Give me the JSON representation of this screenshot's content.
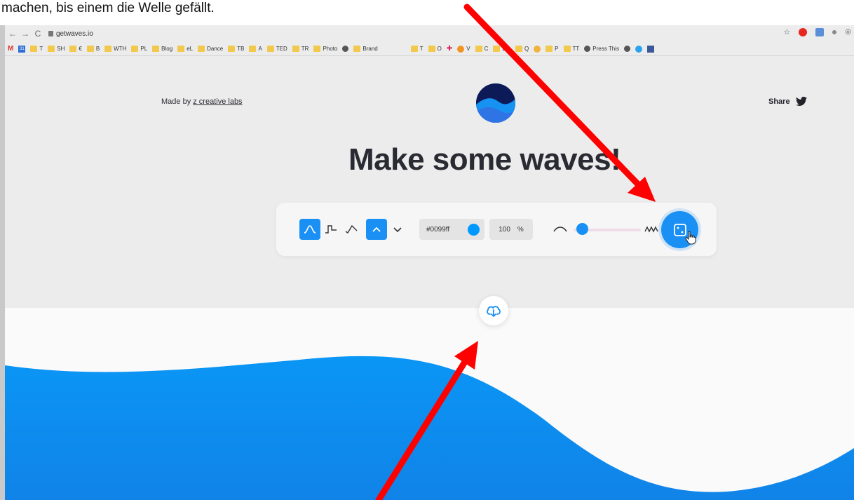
{
  "caption": "machen, bis einem die Welle gefällt.",
  "browser": {
    "url": "getwaves.io",
    "bookmarks": [
      "T",
      "SH",
      "€",
      "B",
      "WTH",
      "PL",
      "Blog",
      "eL",
      "Dance",
      "TB",
      "A",
      "TED",
      "TR",
      "Photo",
      "Brand",
      "T",
      "O",
      "V",
      "C",
      "EO",
      "Q",
      "P",
      "TT",
      "Press This"
    ]
  },
  "page": {
    "made_by_prefix": "Made by ",
    "made_by_link": "z creative labs",
    "share_label": "Share",
    "headline": "Make some waves!"
  },
  "toolbar": {
    "color_hex": "#0099ff",
    "opacity_value": "100",
    "opacity_unit": "%",
    "complexity_level": 0.05
  },
  "colors": {
    "accent": "#1a90f5",
    "wave": "#0099ff",
    "arrow": "#ff0000",
    "logo_dark": "#0c1a57"
  }
}
